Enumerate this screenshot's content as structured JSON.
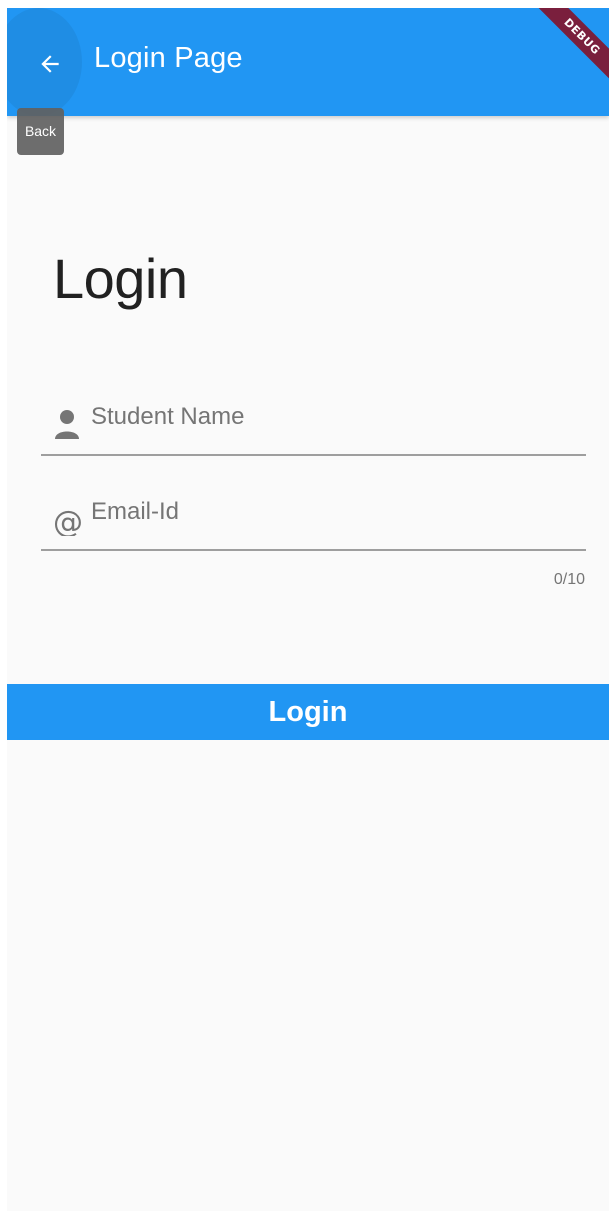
{
  "appbar": {
    "title": "Login Page",
    "back_icon": "arrow-left-icon",
    "debug_banner": "DEBUG"
  },
  "tooltip": {
    "text": "Back"
  },
  "main": {
    "heading": "Login",
    "fields": [
      {
        "icon": "person-icon",
        "placeholder": "Student Name",
        "value": ""
      },
      {
        "icon": "at-sign-icon",
        "placeholder": "Email-Id",
        "value": "",
        "counter": "0/10"
      }
    ],
    "button_label": "Login"
  },
  "colors": {
    "primary": "#2196f3",
    "debug_banner": "#7a1f3d",
    "background": "#fafafa"
  }
}
